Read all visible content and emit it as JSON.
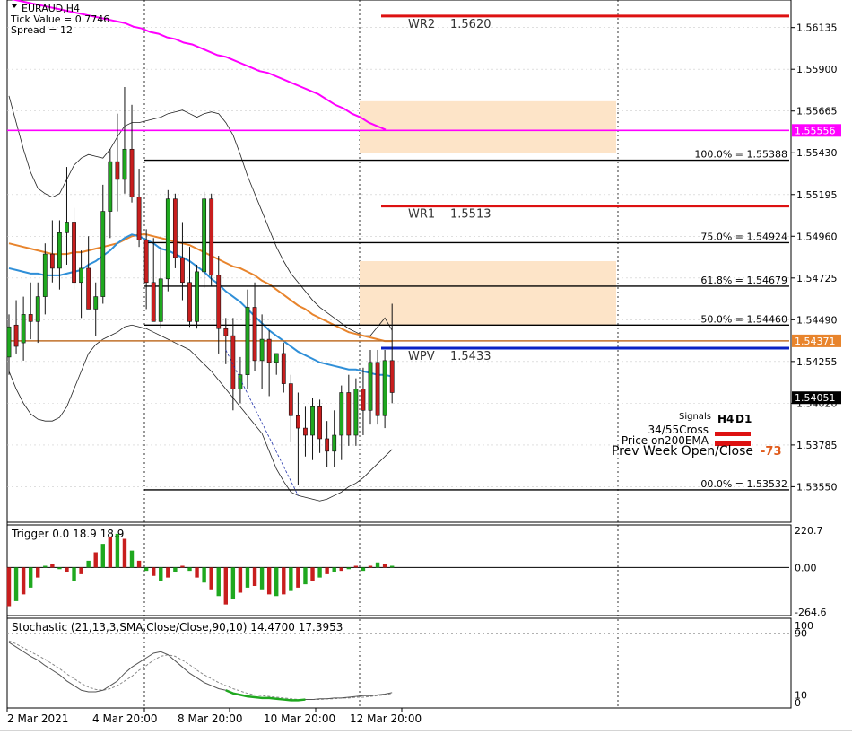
{
  "info": {
    "symbol": "EURAUD,H4",
    "tick_value": "Tick Value = 0.7746",
    "spread": "Spread = 12"
  },
  "chart_data": {
    "type": "candlestick",
    "symbol": "EURAUD",
    "timeframe": "H4",
    "ylim": [
      1.5335,
      1.5629
    ],
    "price_ticks": [
      "1.56135",
      "1.55900",
      "1.55665",
      "1.55430",
      "1.55195",
      "1.54960",
      "1.54725",
      "1.54490",
      "1.54255",
      "1.54020",
      "1.53785",
      "1.53550"
    ],
    "x_ticks": [
      "2 Mar 2021",
      "4 Mar 20:00",
      "8 Mar 20:00",
      "10 Mar 20:00",
      "12 Mar 20:00"
    ],
    "price_tags": [
      {
        "label": "1.55556",
        "value": 1.55556,
        "bg": "#ff00ff",
        "fg": "#ffffff"
      },
      {
        "label": "1.54371",
        "value": 1.54371,
        "bg": "#e8842c",
        "fg": "#ffffff"
      },
      {
        "label": "1.54051",
        "value": 1.54051,
        "bg": "#000000",
        "fg": "#ffffff"
      }
    ],
    "candles": [
      [
        1.5428,
        1.5452,
        1.5418,
        1.5445
      ],
      [
        1.5446,
        1.546,
        1.543,
        1.5434
      ],
      [
        1.5436,
        1.5462,
        1.5426,
        1.5452
      ],
      [
        1.5452,
        1.547,
        1.5438,
        1.5448
      ],
      [
        1.5448,
        1.547,
        1.5436,
        1.5462
      ],
      [
        1.5462,
        1.5492,
        1.5452,
        1.5486
      ],
      [
        1.5486,
        1.5505,
        1.547,
        1.5478
      ],
      [
        1.5478,
        1.5505,
        1.5466,
        1.5498
      ],
      [
        1.5498,
        1.5535,
        1.548,
        1.5504
      ],
      [
        1.5504,
        1.5512,
        1.5466,
        1.547
      ],
      [
        1.547,
        1.5488,
        1.545,
        1.5478
      ],
      [
        1.5478,
        1.5496,
        1.5458,
        1.5455
      ],
      [
        1.5455,
        1.547,
        1.544,
        1.5462
      ],
      [
        1.5462,
        1.5525,
        1.5458,
        1.551
      ],
      [
        1.551,
        1.5545,
        1.5495,
        1.5538
      ],
      [
        1.5538,
        1.5565,
        1.551,
        1.5528
      ],
      [
        1.5528,
        1.558,
        1.552,
        1.5545
      ],
      [
        1.5545,
        1.557,
        1.5515,
        1.5518
      ],
      [
        1.5518,
        1.5534,
        1.549,
        1.5494
      ],
      [
        1.5494,
        1.55,
        1.5455,
        1.547
      ],
      [
        1.547,
        1.5495,
        1.5448,
        1.5448
      ],
      [
        1.5448,
        1.549,
        1.5444,
        1.5472
      ],
      [
        1.5472,
        1.5522,
        1.5465,
        1.5517
      ],
      [
        1.5517,
        1.552,
        1.5478,
        1.5484
      ],
      [
        1.5484,
        1.5504,
        1.546,
        1.547
      ],
      [
        1.547,
        1.549,
        1.5445,
        1.5448
      ],
      [
        1.5448,
        1.548,
        1.5444,
        1.5476
      ],
      [
        1.5476,
        1.5521,
        1.5467,
        1.5517
      ],
      [
        1.5517,
        1.552,
        1.5468,
        1.5474
      ],
      [
        1.5474,
        1.5485,
        1.543,
        1.5444
      ],
      [
        1.5444,
        1.545,
        1.5424,
        1.544
      ],
      [
        1.544,
        1.545,
        1.5398,
        1.541
      ],
      [
        1.541,
        1.5428,
        1.5402,
        1.5418
      ],
      [
        1.5418,
        1.5466,
        1.541,
        1.5456
      ],
      [
        1.5456,
        1.547,
        1.542,
        1.5426
      ],
      [
        1.5426,
        1.5452,
        1.541,
        1.5438
      ],
      [
        1.5438,
        1.5443,
        1.5406,
        1.5425
      ],
      [
        1.5425,
        1.543,
        1.5418,
        1.543
      ],
      [
        1.543,
        1.5436,
        1.5408,
        1.5413
      ],
      [
        1.5413,
        1.5418,
        1.538,
        1.5395
      ],
      [
        1.5395,
        1.5408,
        1.5356,
        1.5388
      ],
      [
        1.5388,
        1.54,
        1.5372,
        1.5384
      ],
      [
        1.5384,
        1.5405,
        1.537,
        1.54
      ],
      [
        1.54,
        1.5404,
        1.5374,
        1.5382
      ],
      [
        1.5382,
        1.5392,
        1.5366,
        1.5375
      ],
      [
        1.5375,
        1.5398,
        1.5366,
        1.5384
      ],
      [
        1.5384,
        1.5412,
        1.537,
        1.5408
      ],
      [
        1.5408,
        1.5418,
        1.5378,
        1.5384
      ],
      [
        1.5384,
        1.5416,
        1.5378,
        1.541
      ],
      [
        1.541,
        1.5422,
        1.5384,
        1.5398
      ],
      [
        1.5398,
        1.5432,
        1.539,
        1.5425
      ],
      [
        1.5425,
        1.5432,
        1.539,
        1.5395
      ],
      [
        1.5395,
        1.5432,
        1.5388,
        1.5426
      ],
      [
        1.5426,
        1.5458,
        1.5402,
        1.5408
      ]
    ],
    "moving_averages": [
      {
        "color": "#e8842c",
        "values": [
          1.5492,
          1.5491,
          1.549,
          1.5489,
          1.5488,
          1.5487,
          1.5486,
          1.5486,
          1.5486,
          1.5487,
          1.5487,
          1.5488,
          1.5489,
          1.549,
          1.5491,
          1.5492,
          1.5494,
          1.5496,
          1.5497,
          1.5497,
          1.5496,
          1.5495,
          1.5494,
          1.5493,
          1.5492,
          1.5491,
          1.5489,
          1.5487,
          1.5485,
          1.5483,
          1.5481,
          1.5479,
          1.5478,
          1.5476,
          1.5474,
          1.5471,
          1.5469,
          1.5466,
          1.5463,
          1.546,
          1.5457,
          1.5455,
          1.5452,
          1.545,
          1.5448,
          1.5446,
          1.5444,
          1.5442,
          1.5441,
          1.544,
          1.5439,
          1.5438,
          1.5437,
          1.5437
        ]
      },
      {
        "color": "#2f8fd8",
        "values": [
          1.5478,
          1.5477,
          1.5476,
          1.5475,
          1.5475,
          1.5474,
          1.5474,
          1.5474,
          1.5475,
          1.5476,
          1.5477,
          1.548,
          1.5482,
          1.5485,
          1.5488,
          1.5492,
          1.5495,
          1.5497,
          1.5496,
          1.5494,
          1.5492,
          1.5489,
          1.5488,
          1.5486,
          1.5484,
          1.5482,
          1.5479,
          1.5476,
          1.5472,
          1.5469,
          1.5465,
          1.5462,
          1.5459,
          1.5455,
          1.5451,
          1.5447,
          1.5443,
          1.544,
          1.5437,
          1.5434,
          1.5431,
          1.5429,
          1.5427,
          1.5425,
          1.5424,
          1.5423,
          1.5422,
          1.5421,
          1.5421,
          1.542,
          1.5419,
          1.5418,
          1.5418,
          1.5417
        ]
      },
      {
        "color": "#ff00ff",
        "values": [
          1.563,
          1.5629,
          1.5628,
          1.5627,
          1.5626,
          1.5625,
          1.5624,
          1.5623,
          1.5622,
          1.5621,
          1.562,
          1.5619,
          1.5618,
          1.5617,
          1.5616,
          1.5614,
          1.5613,
          1.5611,
          1.561,
          1.5608,
          1.5607,
          1.5605,
          1.5604,
          1.5602,
          1.56,
          1.5598,
          1.5597,
          1.5595,
          1.5593,
          1.5591,
          1.5589,
          1.5588,
          1.5586,
          1.5584,
          1.5582,
          1.558,
          1.5578,
          1.5576,
          1.5573,
          1.557,
          1.5568,
          1.5565,
          1.5563,
          1.556,
          1.5558,
          1.5556
        ]
      }
    ],
    "bands": [
      {
        "values": [
          1.5575,
          1.556,
          1.5545,
          1.5532,
          1.5523,
          1.552,
          1.5518,
          1.552,
          1.5528,
          1.5536,
          1.554,
          1.5542,
          1.5541,
          1.554,
          1.5545,
          1.5552,
          1.5558,
          1.556,
          1.556,
          1.5561,
          1.5562,
          1.5563,
          1.5565,
          1.5566,
          1.5567,
          1.5565,
          1.5563,
          1.5565,
          1.5566,
          1.5565,
          1.556,
          1.5553,
          1.5542,
          1.553,
          1.552,
          1.551,
          1.55,
          1.549,
          1.5482,
          1.5475,
          1.547,
          1.5465,
          1.546,
          1.5456,
          1.5453,
          1.545,
          1.5447,
          1.5444,
          1.5442,
          1.544,
          1.544,
          1.5445,
          1.545,
          1.5443
        ]
      },
      {
        "values": [
          1.542,
          1.541,
          1.5402,
          1.5396,
          1.5393,
          1.5392,
          1.5392,
          1.5394,
          1.54,
          1.541,
          1.542,
          1.543,
          1.5435,
          1.5438,
          1.544,
          1.5442,
          1.5445,
          1.5446,
          1.5445,
          1.5444,
          1.5442,
          1.544,
          1.5438,
          1.5436,
          1.5434,
          1.5432,
          1.5428,
          1.5424,
          1.542,
          1.5415,
          1.541,
          1.5405,
          1.54,
          1.5395,
          1.539,
          1.5385,
          1.5375,
          1.5365,
          1.5358,
          1.5352,
          1.535,
          1.5349,
          1.5348,
          1.5347,
          1.5348,
          1.535,
          1.5352,
          1.5355,
          1.5357,
          1.536,
          1.5364,
          1.5368,
          1.5372,
          1.5376
        ]
      }
    ],
    "zones": [
      {
        "from_bar": 44,
        "to_bar": 68,
        "low": 1.5572,
        "high": 1.5543
      },
      {
        "from_bar": 44,
        "to_bar": 68,
        "low": 1.5482,
        "high": 1.5446
      }
    ],
    "weekly_pivots": [
      {
        "label": "WR2",
        "value": "1.5620",
        "price": 1.562,
        "color": "#dd1111"
      },
      {
        "label": "WR1",
        "value": "1.5513",
        "price": 1.5513,
        "color": "#dd1111"
      },
      {
        "label": "WPV",
        "value": "1.5433",
        "price": 1.5433,
        "color": "#0b24c4"
      }
    ],
    "fibonacci": [
      {
        "label": "100.0% = 1.55388",
        "price": 1.55388
      },
      {
        "label": "75.0% = 1.54924",
        "price": 1.54924
      },
      {
        "label": "61.8% = 1.54679",
        "price": 1.54679
      },
      {
        "label": "50.0% = 1.54460",
        "price": 1.5446
      },
      {
        "label": "00.0% = 1.53532",
        "price": 1.53532
      }
    ],
    "signals": {
      "title": "Signals",
      "columns": [
        "H4",
        "D1"
      ],
      "rows": [
        "34/55Cross",
        "Price on200EMA"
      ],
      "prev_week_label": "Prev Week Open/Close",
      "prev_week_value": "-73"
    },
    "trigger": {
      "label": "Trigger 0.0 18.9 18.9",
      "ticks": [
        "220.7",
        "0.00",
        "-264.6"
      ],
      "ylim": [
        -264.6,
        220.7
      ],
      "values": [
        -230,
        -200,
        -160,
        -120,
        -60,
        10,
        20,
        -10,
        -30,
        -80,
        -40,
        40,
        90,
        140,
        180,
        200,
        170,
        100,
        40,
        -20,
        -50,
        -80,
        -60,
        -30,
        10,
        -20,
        -60,
        -90,
        -130,
        -170,
        -220,
        -190,
        -150,
        -120,
        -110,
        -130,
        -160,
        -170,
        -160,
        -140,
        -120,
        -100,
        -80,
        -60,
        -40,
        -30,
        -20,
        -10,
        10,
        -20,
        10,
        30,
        20,
        10
      ]
    },
    "stochastic": {
      "label": "Stochastic (21,13,3,SMA,Close/Close,90,10) 14.4700 17.3953",
      "ticks": [
        "100",
        "90",
        "10",
        "0"
      ],
      "ylim": [
        0,
        100
      ],
      "main": [
        78,
        72,
        66,
        60,
        55,
        48,
        42,
        36,
        28,
        22,
        16,
        14,
        14,
        16,
        22,
        28,
        38,
        46,
        52,
        58,
        64,
        66,
        62,
        54,
        46,
        38,
        32,
        26,
        22,
        18,
        16,
        12,
        10,
        8,
        7,
        6,
        6,
        5,
        4,
        3,
        3,
        4,
        4,
        5,
        5,
        6,
        6,
        7,
        8,
        9,
        9,
        10,
        11,
        13
      ],
      "signal": [
        80,
        76,
        71,
        66,
        61,
        56,
        50,
        44,
        37,
        31,
        25,
        20,
        17,
        16,
        18,
        22,
        28,
        34,
        42,
        48,
        55,
        60,
        62,
        60,
        55,
        49,
        42,
        36,
        31,
        26,
        22,
        18,
        15,
        12,
        10,
        9,
        8,
        7,
        6,
        5,
        4,
        4,
        4,
        4,
        5,
        5,
        6,
        6,
        7,
        7,
        8,
        9,
        10,
        12
      ],
      "oversold_from_bar": 30
    }
  }
}
